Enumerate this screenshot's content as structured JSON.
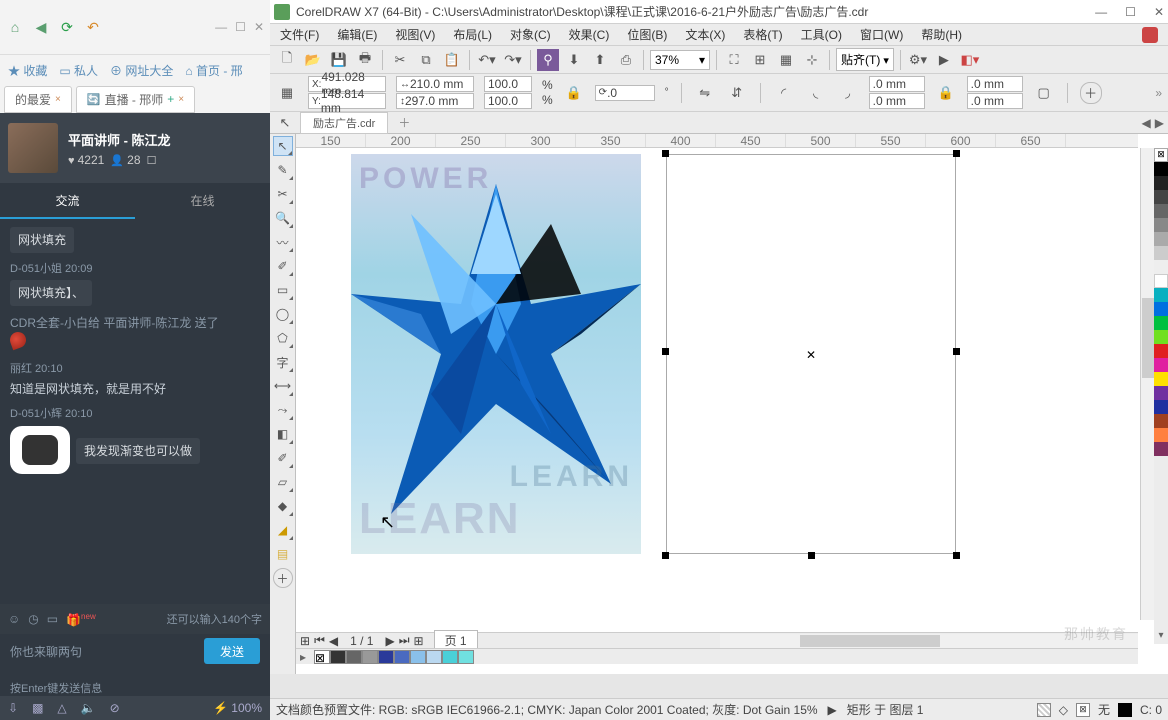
{
  "left": {
    "toolbar": {
      "fav": "收藏",
      "priv": "私人",
      "all": "网址大全",
      "home": "首页 - 邢"
    },
    "tabs": {
      "t1": "的最爱",
      "t2": "直播 - 邢师"
    },
    "profile": {
      "name": "平面讲师 - 陈江龙",
      "heart": "4221",
      "users": "28"
    },
    "nav": {
      "chat": "交流",
      "online": "在线"
    },
    "msgs": {
      "m1_body": "网状填充",
      "m2_meta": "D-051小姐 20:09",
      "m2_body": "网状填充】、",
      "m3_meta": "CDR全套-小白给 平面讲师-陈江龙 送了",
      "m4_meta": "丽红 20:10",
      "m4_body": "知道是网状填充，就是用不好",
      "m5_meta": "D-051小辉 20:10",
      "m5_body": "我发现渐变也可以做"
    },
    "input_hint": "还可以输入140个字",
    "entry_placeholder": "你也来聊两句",
    "enter_hint": "按Enter键发送信息",
    "send": "发送",
    "bottom": {
      "eco": "⚡",
      "zoom": "100%"
    }
  },
  "cdr": {
    "title": "CorelDRAW X7 (64-Bit) - C:\\Users\\Administrator\\Desktop\\课程\\正式课\\2016-6-21户外励志广告\\励志广告.cdr",
    "menu": {
      "file": "文件(F)",
      "edit": "编辑(E)",
      "view": "视图(V)",
      "layout": "布局(L)",
      "object": "对象(C)",
      "effect": "效果(C)",
      "bitmap": "位图(B)",
      "text": "文本(X)",
      "table": "表格(T)",
      "tools": "工具(O)",
      "window": "窗口(W)",
      "help": "帮助(H)"
    },
    "zoom": "37%",
    "snap": "贴齐(T)",
    "prop": {
      "x": "491.028 mm",
      "y": "148.814 mm",
      "w": "210.0 mm",
      "h": "297.0 mm",
      "sx": "100.0",
      "sy": "100.0",
      "rot": ".0",
      "nudge1": ".0 mm",
      "nudge2": ".0 mm",
      "pct": "%"
    },
    "doctab": "励志广告.cdr",
    "ruler": [
      "150",
      "200",
      "250",
      "300",
      "350",
      "400",
      "450",
      "500",
      "550",
      "600",
      "650"
    ],
    "pagenav": {
      "pages": "1 / 1",
      "page1": "页 1"
    },
    "status": {
      "profile": "文档颜色预置文件: RGB: sRGB IEC61966-2.1; CMYK: Japan Color 2001 Coated; 灰度: Dot Gain 15%",
      "obj": "矩形 于 图层 1",
      "none": "无",
      "fill": "C: 0"
    },
    "watermark": "那帅教育"
  }
}
